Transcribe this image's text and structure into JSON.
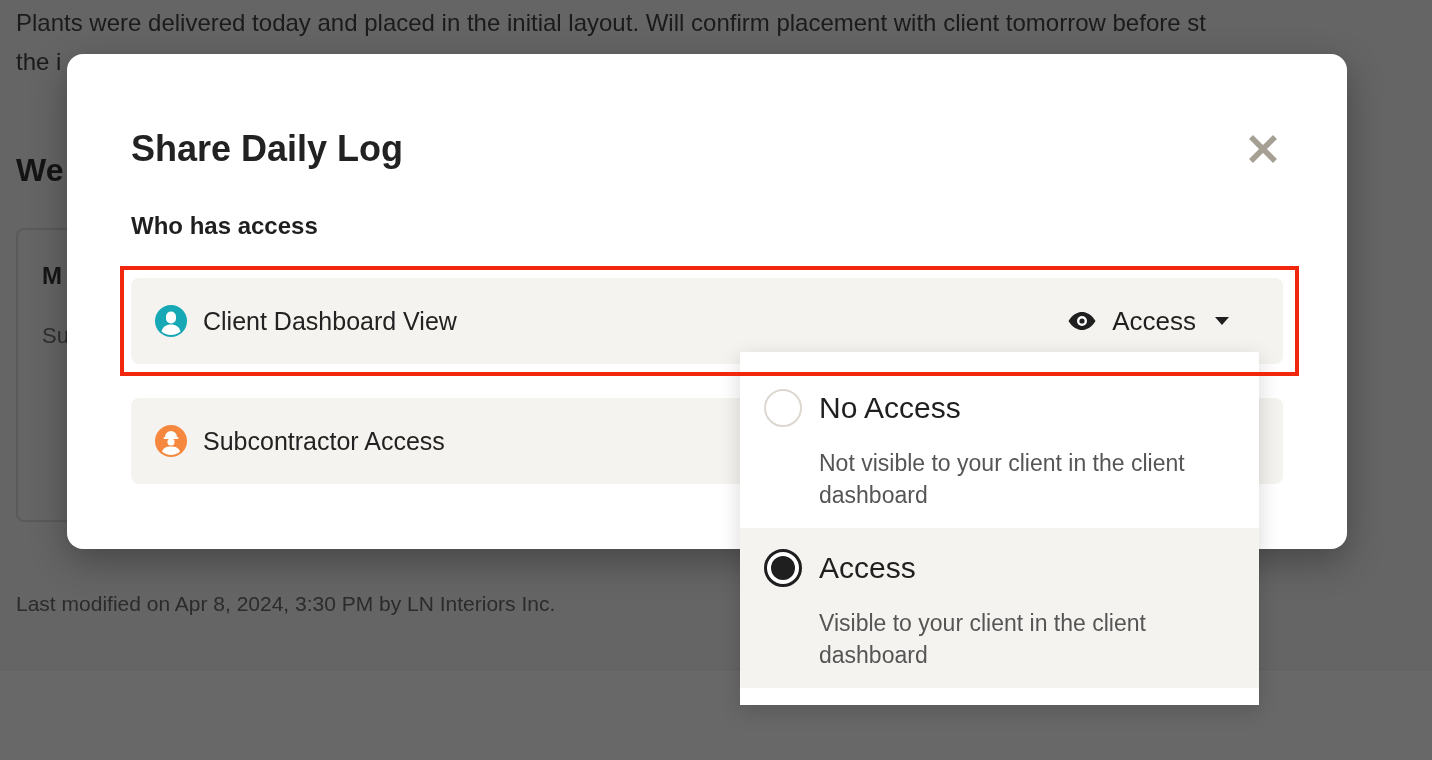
{
  "page": {
    "note_lines": [
      "Plants were delivered today and placed in the initial layout. Will confirm placement with client tomorrow before st",
      "the i"
    ],
    "section_heading": "We",
    "card": {
      "title": "M",
      "text": "Su"
    },
    "last_modified": "Last modified on Apr 8, 2024, 3:30 PM by LN Interiors Inc."
  },
  "dialog": {
    "title": "Share Daily Log",
    "section_label": "Who has access",
    "rows": [
      {
        "kind": "client",
        "label": "Client Dashboard View",
        "color": "#17a8b6",
        "highlighted": true,
        "access": "Access",
        "access_menu": {
          "options": [
            {
              "label": "No Access",
              "description": "Not visible to your client in the client dashboard",
              "selected": false
            },
            {
              "label": "Access",
              "description": "Visible to your client in the client dashboard",
              "selected": true
            }
          ]
        }
      },
      {
        "kind": "subcontractor",
        "label": "Subcontractor Access",
        "color": "#f6873e",
        "highlighted": false
      }
    ]
  }
}
